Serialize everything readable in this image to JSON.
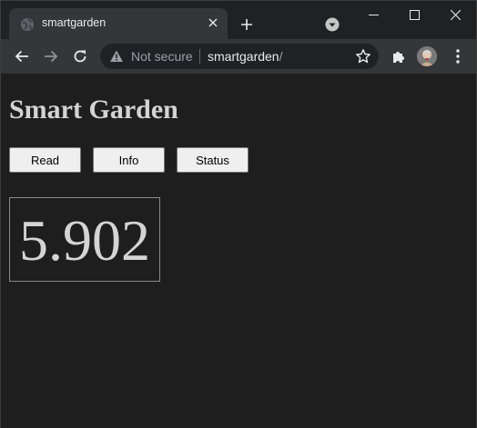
{
  "browser": {
    "tab_title": "smartgarden",
    "security_label": "Not secure",
    "url_host": "smartgarden",
    "url_path": "/"
  },
  "page": {
    "heading": "Smart Garden",
    "buttons": {
      "read": "Read",
      "info": "Info",
      "status": "Status"
    },
    "reading": "5.902"
  },
  "icons": {
    "favicon": "globe-icon",
    "tab_close": "close-icon",
    "new_tab": "plus-icon",
    "tab_search": "dropdown-icon",
    "minimize": "minimize-icon",
    "maximize": "maximize-icon",
    "window_close": "close-icon",
    "back": "back-arrow-icon",
    "forward": "forward-arrow-icon",
    "reload": "reload-icon",
    "security": "warning-icon",
    "bookmark": "star-icon",
    "extensions": "puzzle-icon",
    "menu": "kebab-menu-icon"
  },
  "colors": {
    "page_background": "#1e1e1e",
    "text": "#d4d4d4",
    "button_background": "#efefef"
  }
}
